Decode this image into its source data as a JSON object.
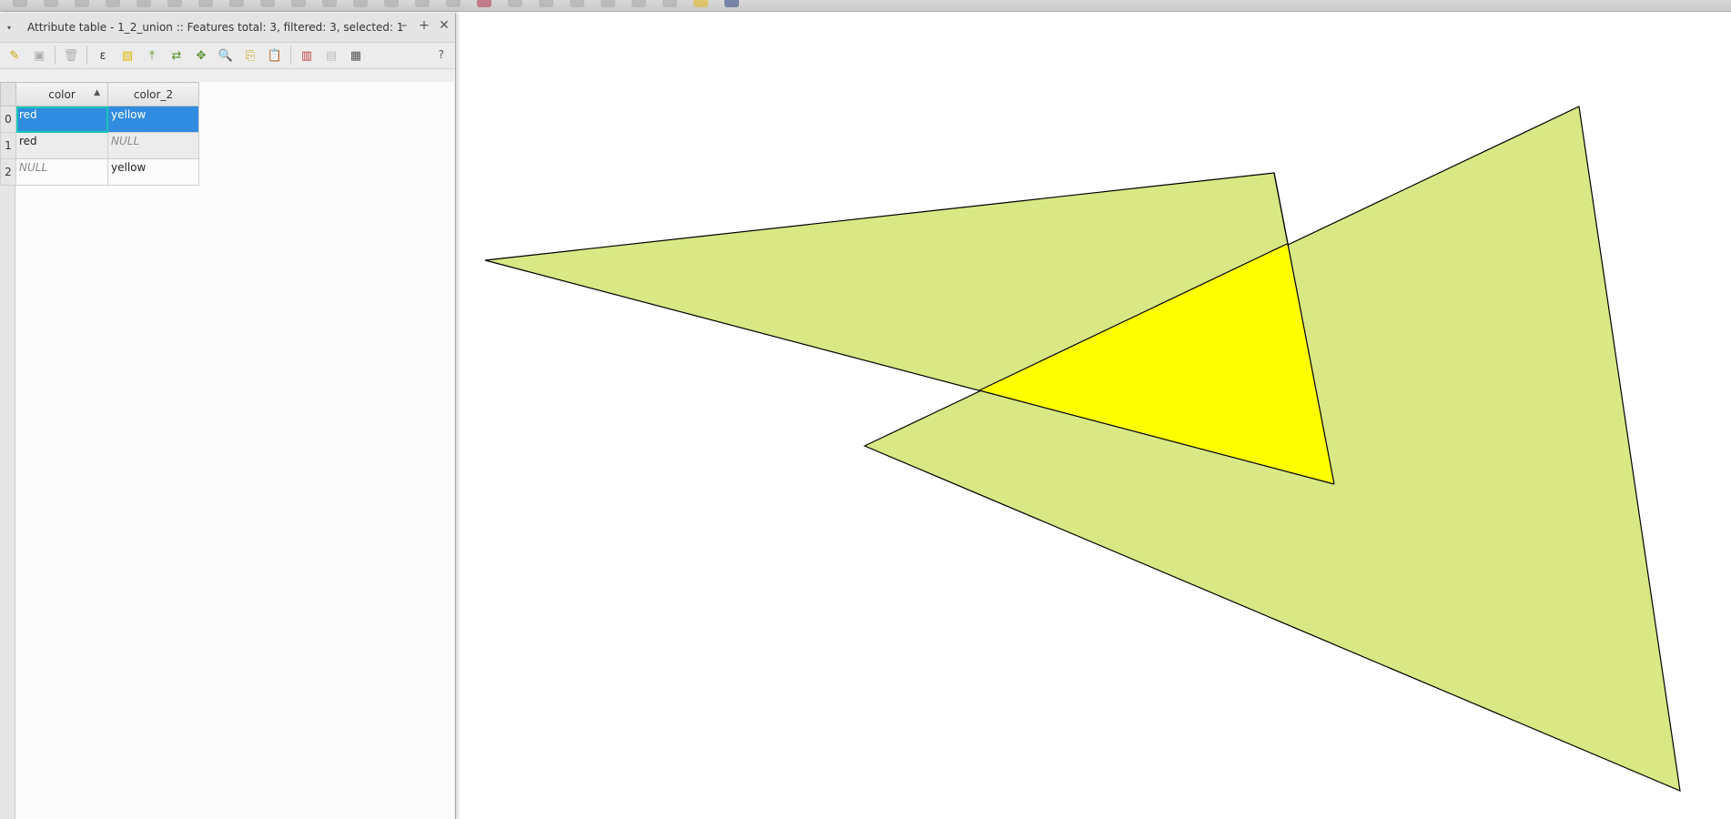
{
  "window": {
    "title": "Attribute table - 1_2_union :: Features total: 3, filtered: 3, selected: 1",
    "collapse_glyph": "▾",
    "minimize_glyph": "–",
    "float_glyph": "+",
    "close_glyph": "✕",
    "help_label": "?"
  },
  "toolbar": {
    "tools": [
      {
        "name": "toggle-editing-icon",
        "glyph": "✎",
        "color": "#c9a400"
      },
      {
        "name": "save-edits-icon",
        "glyph": "▣",
        "color": "#7a7a7a"
      },
      {
        "name": "delete-features-icon",
        "glyph": "🗑",
        "color": "#7a7a7a"
      },
      {
        "name": "select-by-expression-icon",
        "glyph": "ε",
        "color": "#333333"
      },
      {
        "name": "deselect-all-icon",
        "glyph": "▧",
        "color": "#e0b800"
      },
      {
        "name": "move-selection-to-top-icon",
        "glyph": "⤒",
        "color": "#5a8f2a"
      },
      {
        "name": "invert-selection-icon",
        "glyph": "⇄",
        "color": "#5a8f2a"
      },
      {
        "name": "pan-to-selected-icon",
        "glyph": "✥",
        "color": "#5a8f2a"
      },
      {
        "name": "zoom-to-selected-icon",
        "glyph": "🔍",
        "color": "#c9a400"
      },
      {
        "name": "copy-rows-icon",
        "glyph": "⎘",
        "color": "#c9a400"
      },
      {
        "name": "paste-features-icon",
        "glyph": "📋",
        "color": "#c9a400"
      },
      {
        "name": "delete-field-icon",
        "glyph": "▥",
        "color": "#c04040"
      },
      {
        "name": "new-field-icon",
        "glyph": "▤",
        "color": "#999999"
      },
      {
        "name": "field-calculator-icon",
        "glyph": "▦",
        "color": "#555555"
      }
    ]
  },
  "table": {
    "columns": [
      {
        "label": "color",
        "sort_glyph": "▲"
      },
      {
        "label": "color_2"
      }
    ],
    "rows": [
      {
        "index": "0",
        "color": "red",
        "color_2": "yellow"
      },
      {
        "index": "1",
        "color": "red",
        "color_2": "NULL"
      },
      {
        "index": "2",
        "color": "NULL",
        "color_2": "yellow"
      }
    ],
    "selected_row": 0
  },
  "map": {
    "fill_light": "#d9e885",
    "fill_overlap": "#ffff00",
    "stroke": "#000000"
  }
}
